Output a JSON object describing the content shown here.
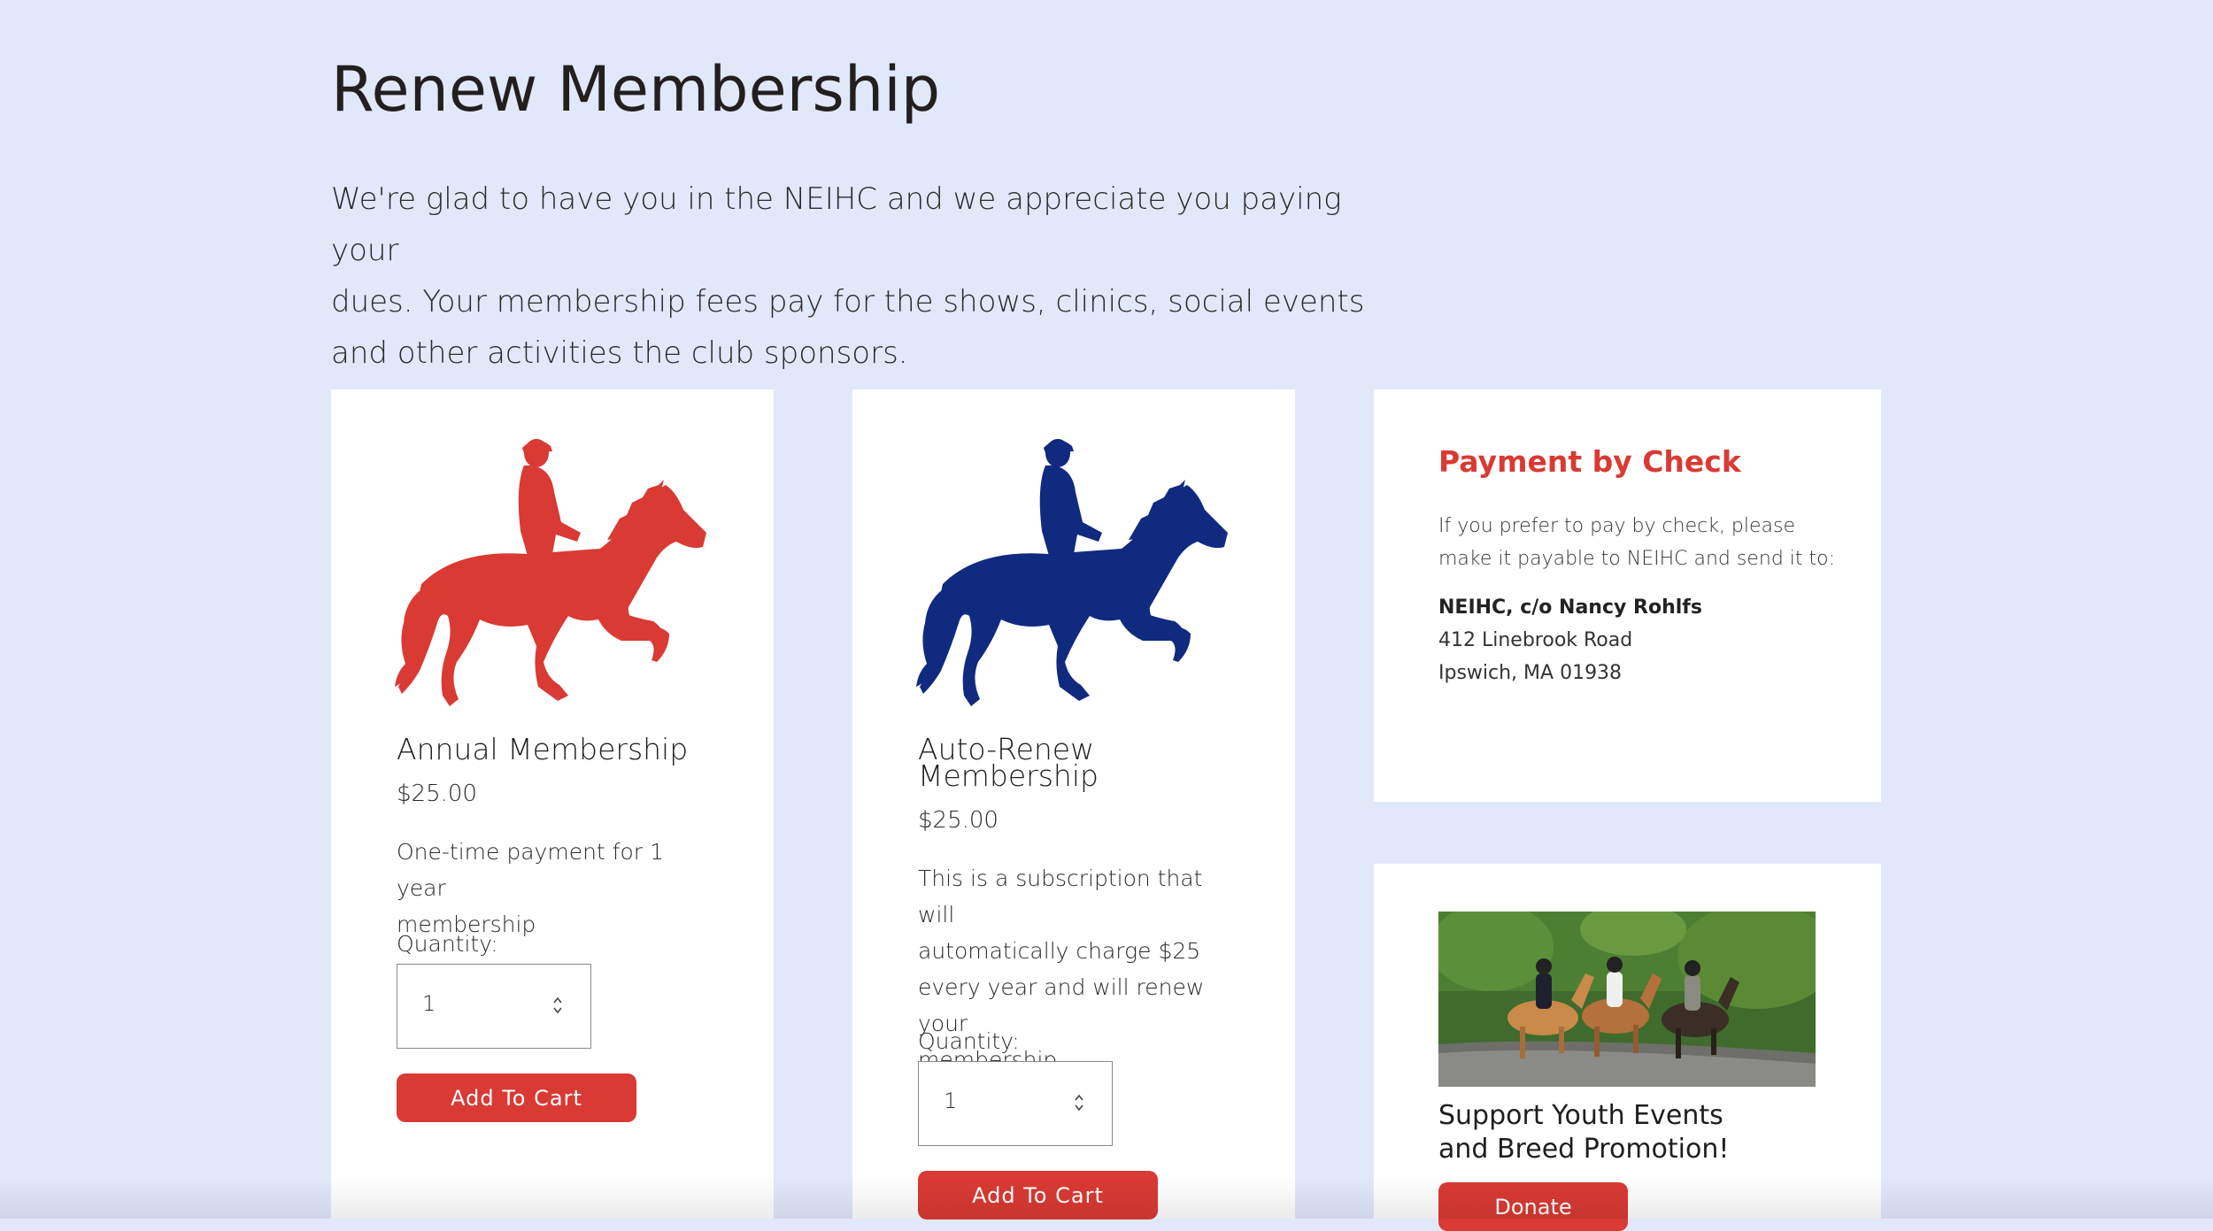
{
  "page": {
    "title": "Renew Membership",
    "intro_line1": "We're glad to have you in the NEIHC and we appreciate you paying your",
    "intro_line2": "dues. Your membership fees pay for the shows, clinics, social events",
    "intro_line3": "and other activities the club sponsors."
  },
  "colors": {
    "background": "#e1e8fa",
    "accent_red": "#d93a33",
    "navy": "#102a80"
  },
  "products": [
    {
      "icon": "horse-rider-red-icon",
      "title": "Annual Membership",
      "price": "$25.00",
      "desc_line1": "One-time payment for 1 year",
      "desc_line2": "membership",
      "quantity_label": "Quantity:",
      "quantity": "1",
      "button": "Add To Cart"
    },
    {
      "icon": "horse-rider-navy-icon",
      "title_line1": "Auto-Renew",
      "title_line2": "Membership",
      "price": "$25.00",
      "desc_line1": "This is a subscription that will",
      "desc_line2": "automatically charge $25",
      "desc_line3": "every year and will renew your",
      "desc_line4": "membership.",
      "quantity_label": "Quantity:",
      "quantity": "1",
      "button": "Add To Cart"
    }
  ],
  "check": {
    "title": "Payment by Check",
    "text_line1": "If you prefer to pay by check, please",
    "text_line2": "make it payable to NEIHC and send it to:",
    "name": "NEIHC, c/o Nancy Rohlfs",
    "street": "412 Linebrook Road",
    "city": "Ipswich, MA 01938"
  },
  "donate": {
    "heading_line1": "Support Youth Events",
    "heading_line2": "and Breed Promotion!",
    "button": "Donate"
  }
}
